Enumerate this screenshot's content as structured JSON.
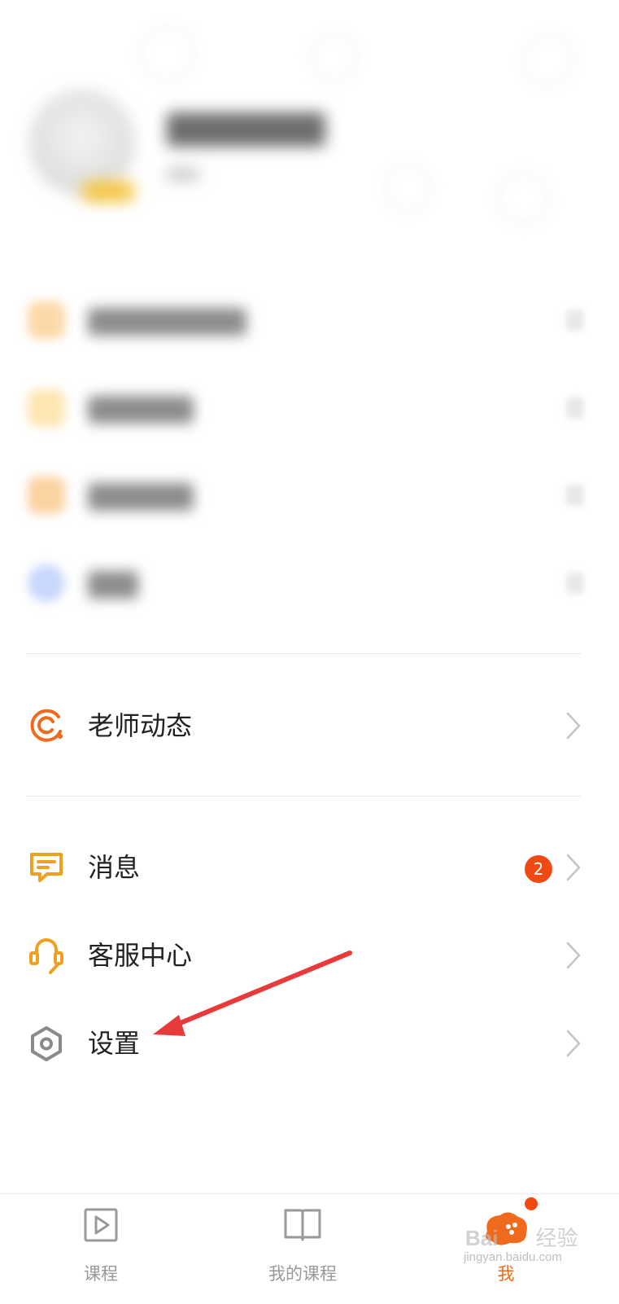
{
  "profile": {
    "username": "",
    "subtitle": "",
    "badge": ""
  },
  "menu_blurred": [
    {
      "label": "",
      "icon": "orange-square-icon",
      "color": "#fcd9a8"
    },
    {
      "label": "",
      "icon": "yellow-square-icon",
      "color": "#fde6b3"
    },
    {
      "label": "",
      "icon": "orange-square-icon",
      "color": "#fbd2a1"
    },
    {
      "label": "",
      "icon": "blue-circle-icon",
      "color": "#c8d7fb"
    }
  ],
  "menu": {
    "teacher_updates": {
      "label": "老师动态",
      "icon": "teacher-dynamic-icon"
    },
    "messages": {
      "label": "消息",
      "badge": "2",
      "icon": "message-icon"
    },
    "customer_service": {
      "label": "客服中心",
      "icon": "headset-icon"
    },
    "settings": {
      "label": "设置",
      "icon": "hexagon-gear-icon"
    }
  },
  "nav": {
    "items": [
      {
        "label": "课程",
        "icon": "play-icon",
        "active": false
      },
      {
        "label": "我的课程",
        "icon": "book-icon",
        "active": false
      },
      {
        "label": "我",
        "icon": "profile-blob-icon",
        "active": true
      }
    ],
    "active_color": "#ef6a1d",
    "inactive_color": "#999999"
  },
  "watermark": {
    "brand": "Bai",
    "brand_suffix": "经验",
    "url": "jingyan.baidu.com"
  },
  "colors": {
    "accent_orange": "#ef6a1d",
    "badge_red": "#f04a12",
    "annotation_arrow": "#e83a3a"
  }
}
